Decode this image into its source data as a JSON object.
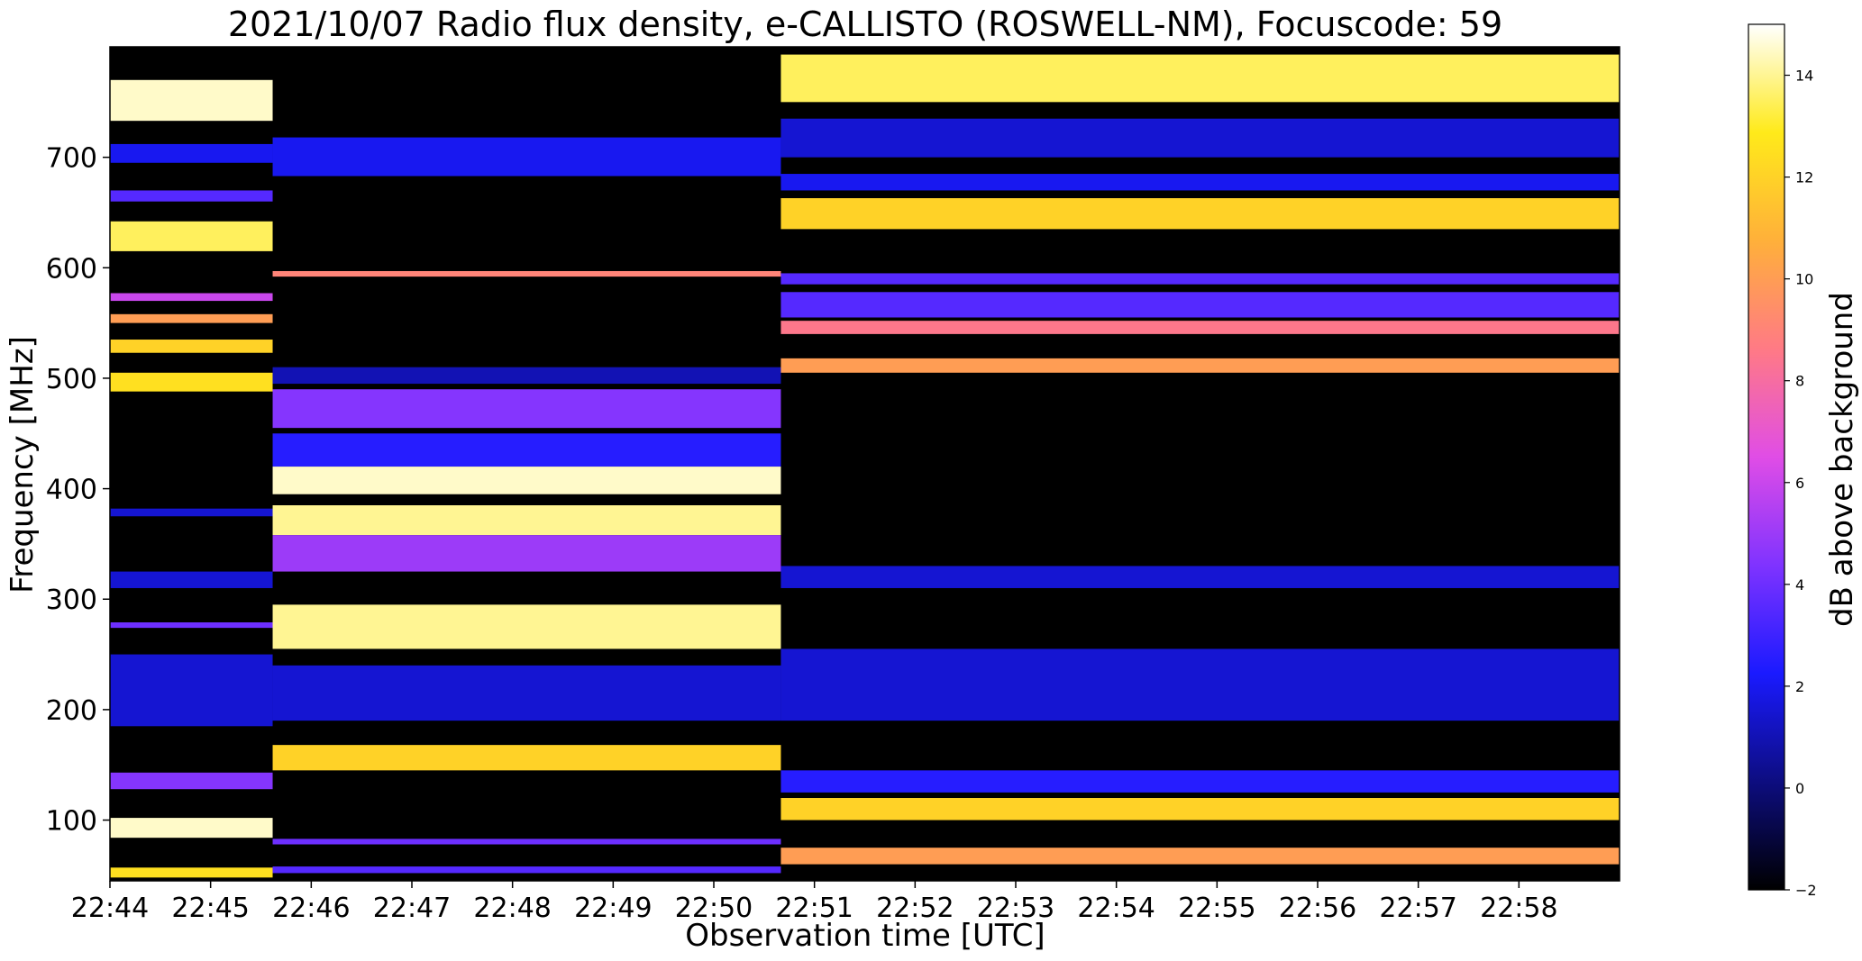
{
  "chart_data": {
    "type": "heatmap",
    "title": "2021/10/07  Radio flux density, e-CALLISTO (ROSWELL-NM), Focuscode: 59",
    "xlabel": "Observation time [UTC]",
    "ylabel": "Frequency [MHz]",
    "x_ticks": [
      "22:44",
      "22:45",
      "22:46",
      "22:47",
      "22:48",
      "22:49",
      "22:50",
      "22:51",
      "22:52",
      "22:53",
      "22:54",
      "22:55",
      "22:56",
      "22:57",
      "22:58"
    ],
    "x_range": [
      "22:44",
      "22:59"
    ],
    "y_ticks": [
      100,
      200,
      300,
      400,
      500,
      600,
      700
    ],
    "y_range": [
      45,
      800
    ],
    "colorbar": {
      "label": "dB above background",
      "ticks": [
        -2,
        0,
        2,
        4,
        6,
        8,
        10,
        12,
        14
      ],
      "range": [
        -2,
        15
      ],
      "colormap": "gnuplot2",
      "stops": [
        "#000000",
        "#0d0d80",
        "#1a1aff",
        "#7f33ff",
        "#e04de6",
        "#ff7a85",
        "#ffb03a",
        "#ffea1a",
        "#ffffff"
      ]
    },
    "segments": [
      {
        "time_start": "22:44:00",
        "time_end": "22:45:37",
        "bands": [
          {
            "f_lo": 733,
            "f_hi": 770,
            "db": 14.5
          },
          {
            "f_lo": 695,
            "f_hi": 712,
            "db": 2
          },
          {
            "f_lo": 660,
            "f_hi": 670,
            "db": 3.5
          },
          {
            "f_lo": 615,
            "f_hi": 642,
            "db": 13.5
          },
          {
            "f_lo": 570,
            "f_hi": 577,
            "db": 6
          },
          {
            "f_lo": 550,
            "f_hi": 558,
            "db": 10
          },
          {
            "f_lo": 523,
            "f_hi": 535,
            "db": 12
          },
          {
            "f_lo": 488,
            "f_hi": 505,
            "db": 12.5
          },
          {
            "f_lo": 375,
            "f_hi": 382,
            "db": 1.5
          },
          {
            "f_lo": 310,
            "f_hi": 325,
            "db": 1.5
          },
          {
            "f_lo": 274,
            "f_hi": 279,
            "db": 4
          },
          {
            "f_lo": 185,
            "f_hi": 250,
            "db": 1.5
          },
          {
            "f_lo": 128,
            "f_hi": 143,
            "db": 4.5
          },
          {
            "f_lo": 84,
            "f_hi": 102,
            "db": 14.5
          },
          {
            "f_lo": 48,
            "f_hi": 57,
            "db": 12.5
          }
        ]
      },
      {
        "time_start": "22:45:37",
        "time_end": "22:50:40",
        "bands": [
          {
            "f_lo": 683,
            "f_hi": 718,
            "db": 2
          },
          {
            "f_lo": 592,
            "f_hi": 597,
            "db": 9
          },
          {
            "f_lo": 495,
            "f_hi": 510,
            "db": 1
          },
          {
            "f_lo": 455,
            "f_hi": 490,
            "db": 4.5
          },
          {
            "f_lo": 420,
            "f_hi": 450,
            "db": 2.5
          },
          {
            "f_lo": 395,
            "f_hi": 420,
            "db": 14.5
          },
          {
            "f_lo": 358,
            "f_hi": 385,
            "db": 14
          },
          {
            "f_lo": 325,
            "f_hi": 358,
            "db": 5
          },
          {
            "f_lo": 255,
            "f_hi": 295,
            "db": 14
          },
          {
            "f_lo": 190,
            "f_hi": 240,
            "db": 1.5
          },
          {
            "f_lo": 145,
            "f_hi": 168,
            "db": 12
          },
          {
            "f_lo": 78,
            "f_hi": 83,
            "db": 4
          },
          {
            "f_lo": 52,
            "f_hi": 58,
            "db": 3.5
          }
        ]
      },
      {
        "time_start": "22:50:40",
        "time_end": "22:59:00",
        "bands": [
          {
            "f_lo": 750,
            "f_hi": 793,
            "db": 13.5
          },
          {
            "f_lo": 700,
            "f_hi": 735,
            "db": 1.5
          },
          {
            "f_lo": 670,
            "f_hi": 685,
            "db": 2
          },
          {
            "f_lo": 635,
            "f_hi": 663,
            "db": 12
          },
          {
            "f_lo": 585,
            "f_hi": 595,
            "db": 3.5
          },
          {
            "f_lo": 555,
            "f_hi": 578,
            "db": 3.5
          },
          {
            "f_lo": 540,
            "f_hi": 552,
            "db": 8.5
          },
          {
            "f_lo": 505,
            "f_hi": 518,
            "db": 10
          },
          {
            "f_lo": 310,
            "f_hi": 330,
            "db": 1.5
          },
          {
            "f_lo": 190,
            "f_hi": 255,
            "db": 1.5
          },
          {
            "f_lo": 125,
            "f_hi": 145,
            "db": 2.5
          },
          {
            "f_lo": 100,
            "f_hi": 120,
            "db": 12
          },
          {
            "f_lo": 60,
            "f_hi": 75,
            "db": 10
          }
        ]
      }
    ]
  }
}
